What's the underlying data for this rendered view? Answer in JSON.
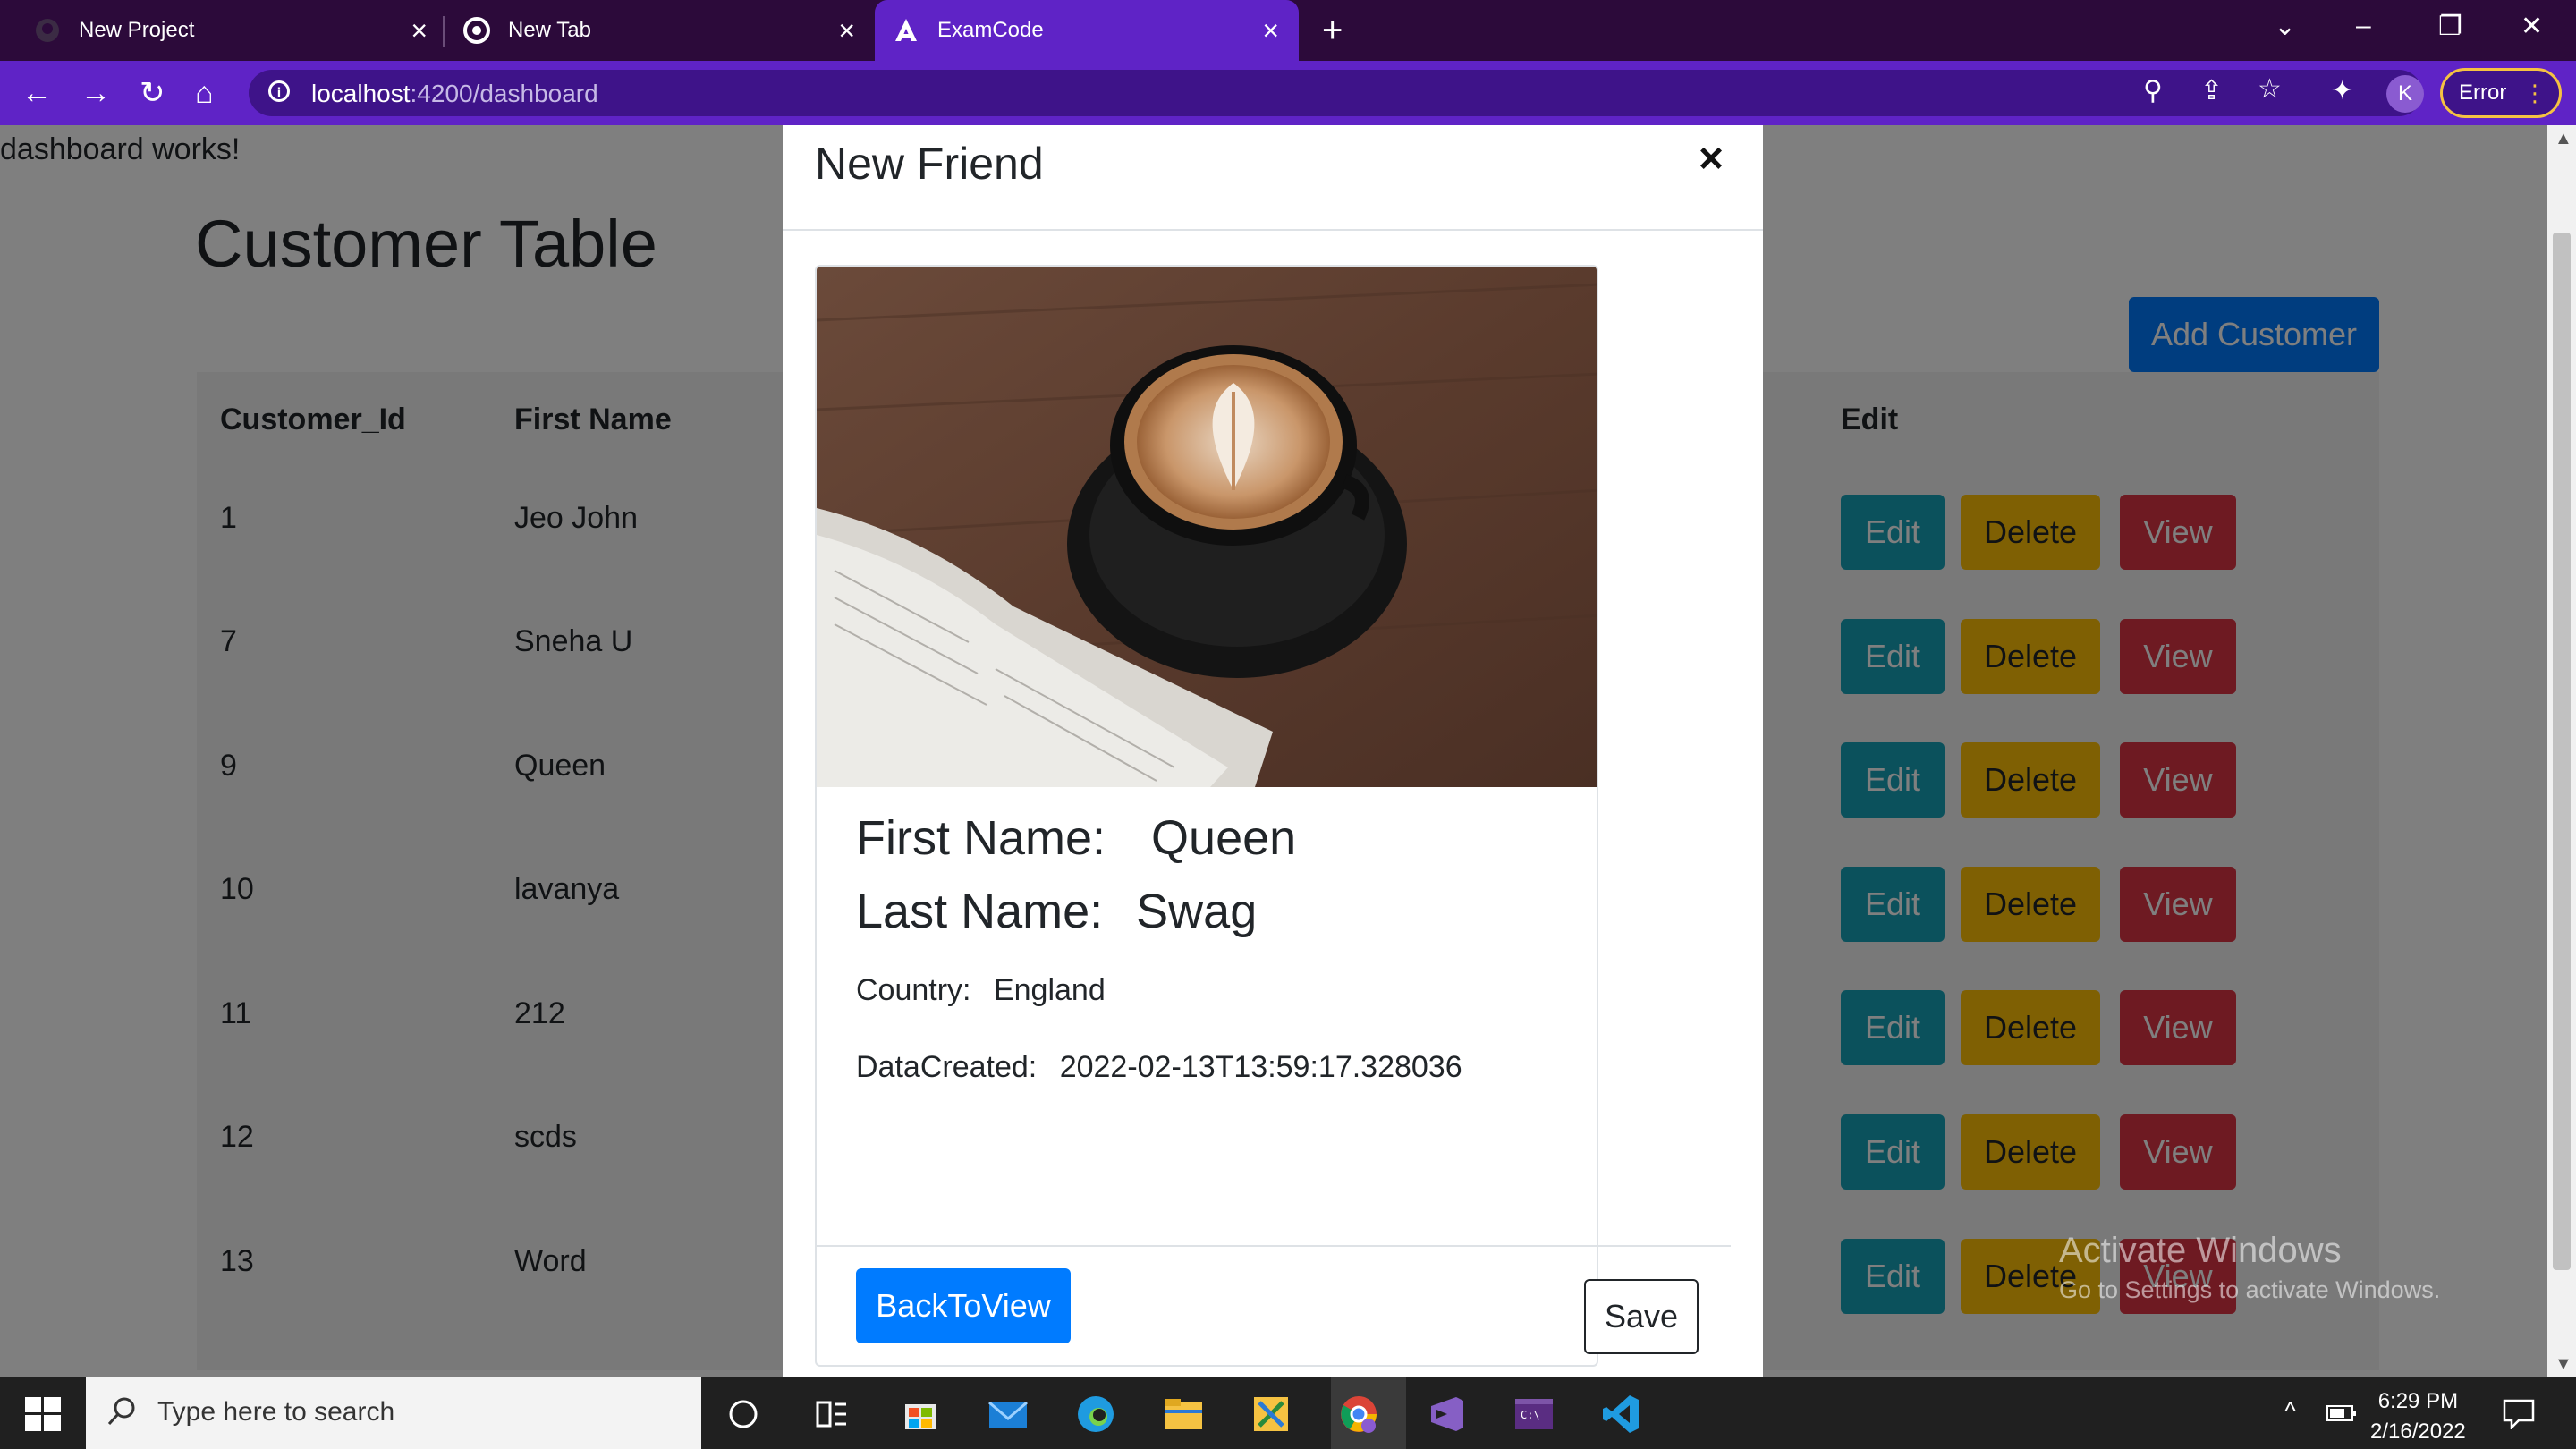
{
  "browser": {
    "tabs": [
      {
        "title": "New Project",
        "icon": "github-icon"
      },
      {
        "title": "New Tab",
        "icon": "chrome-icon"
      },
      {
        "title": "ExamCode",
        "icon": "angular-icon"
      }
    ],
    "url_host": "localhost",
    "url_path": ":4200/dashboard",
    "avatar_letter": "K",
    "error_label": "Error"
  },
  "page": {
    "works_text": "dashboard works!",
    "title": "Customer Table",
    "add_button": "Add Customer",
    "columns": [
      "Customer_Id",
      "First Name",
      "Edit"
    ],
    "rows": [
      {
        "id": "1",
        "first": "Jeo John"
      },
      {
        "id": "7",
        "first": "Sneha U"
      },
      {
        "id": "9",
        "first": "Queen"
      },
      {
        "id": "10",
        "first": "lavanya"
      },
      {
        "id": "11",
        "first": "212"
      },
      {
        "id": "12",
        "first": "scds"
      },
      {
        "id": "13",
        "first": "Word"
      }
    ],
    "edit_label": "Edit",
    "delete_label": "Delete",
    "view_label": "View"
  },
  "modal": {
    "title": "New Friend",
    "close_symbol": "×",
    "first_name_label": "First Name:",
    "first_name": "Queen",
    "last_name_label": "Last Name:",
    "last_name": "Swag",
    "country_label": "Country:",
    "country": "England",
    "created_label": "DataCreated:",
    "created": "2022-02-13T13:59:17.328036",
    "back_button": "BackToView",
    "save_button": "Save"
  },
  "watermark": {
    "line1": "Activate Windows",
    "line2": "Go to Settings to activate Windows."
  },
  "taskbar": {
    "search_placeholder": "Type here to search",
    "time": "6:29 PM",
    "date": "2/16/2022"
  },
  "colors": {
    "primary": "#007bff",
    "info": "#17a2b8",
    "warning": "#ffc107",
    "danger": "#dc3545",
    "browser_accent": "#5f23c6"
  }
}
